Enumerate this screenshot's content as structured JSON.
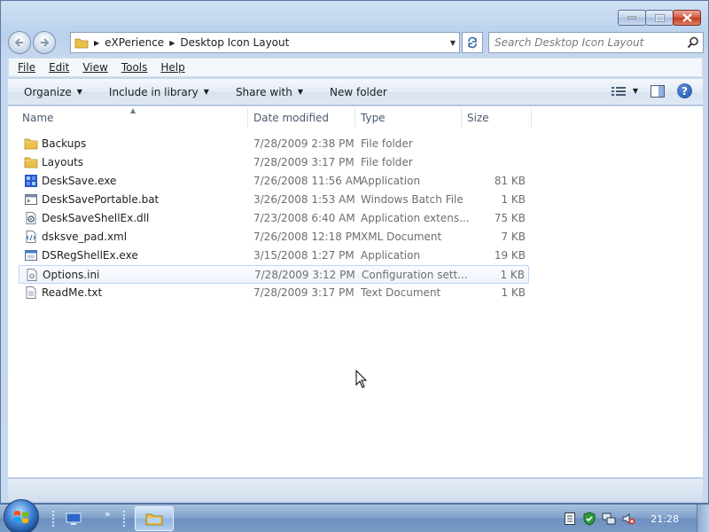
{
  "window": {
    "buttons": {
      "minimize": "minimize",
      "maximize": "maximize",
      "close": "close"
    }
  },
  "address": {
    "crumbs": [
      "eXPerience",
      "Desktop Icon Layout"
    ]
  },
  "search": {
    "placeholder": "Search Desktop Icon Layout"
  },
  "menu": {
    "items": [
      {
        "label": "File",
        "key": "F"
      },
      {
        "label": "Edit",
        "key": "E"
      },
      {
        "label": "View",
        "key": "V"
      },
      {
        "label": "Tools",
        "key": "T"
      },
      {
        "label": "Help",
        "key": "H"
      }
    ]
  },
  "toolbar": {
    "organize": "Organize",
    "include": "Include in library",
    "share": "Share with",
    "new_folder": "New folder"
  },
  "columns": {
    "name": "Name",
    "date": "Date modified",
    "type": "Type",
    "size": "Size"
  },
  "files": [
    {
      "name": "Backups",
      "date": "7/28/2009 2:38 PM",
      "type": "File folder",
      "size": "",
      "icon": "folder-icon"
    },
    {
      "name": "Layouts",
      "date": "7/28/2009 3:17 PM",
      "type": "File folder",
      "size": "",
      "icon": "folder-icon"
    },
    {
      "name": "DeskSave.exe",
      "date": "7/26/2008 11:56 AM",
      "type": "Application",
      "size": "81 KB",
      "icon": "app-icon"
    },
    {
      "name": "DeskSavePortable.bat",
      "date": "3/26/2008 1:53 AM",
      "type": "Windows Batch File",
      "size": "1 KB",
      "icon": "batch-file-icon"
    },
    {
      "name": "DeskSaveShellEx.dll",
      "date": "7/23/2008 6:40 AM",
      "type": "Application extens...",
      "size": "75 KB",
      "icon": "dll-file-icon"
    },
    {
      "name": "dsksve_pad.xml",
      "date": "7/26/2008 12:18 PM",
      "type": "XML Document",
      "size": "7 KB",
      "icon": "xml-file-icon"
    },
    {
      "name": "DSRegShellEx.exe",
      "date": "3/15/2008 1:27 PM",
      "type": "Application",
      "size": "19 KB",
      "icon": "exe-file-icon"
    },
    {
      "name": "Options.ini",
      "date": "7/28/2009 3:12 PM",
      "type": "Configuration sett...",
      "size": "1 KB",
      "icon": "ini-file-icon",
      "hovered": true
    },
    {
      "name": "ReadMe.txt",
      "date": "7/28/2009 3:17 PM",
      "type": "Text Document",
      "size": "1 KB",
      "icon": "text-file-icon"
    }
  ],
  "taskbar": {
    "clock": "21:28"
  },
  "colors": {
    "accent": "#1b4ea5",
    "row_hover_border": "#b8d6fb",
    "folder_yellow": "#e9c04a"
  }
}
